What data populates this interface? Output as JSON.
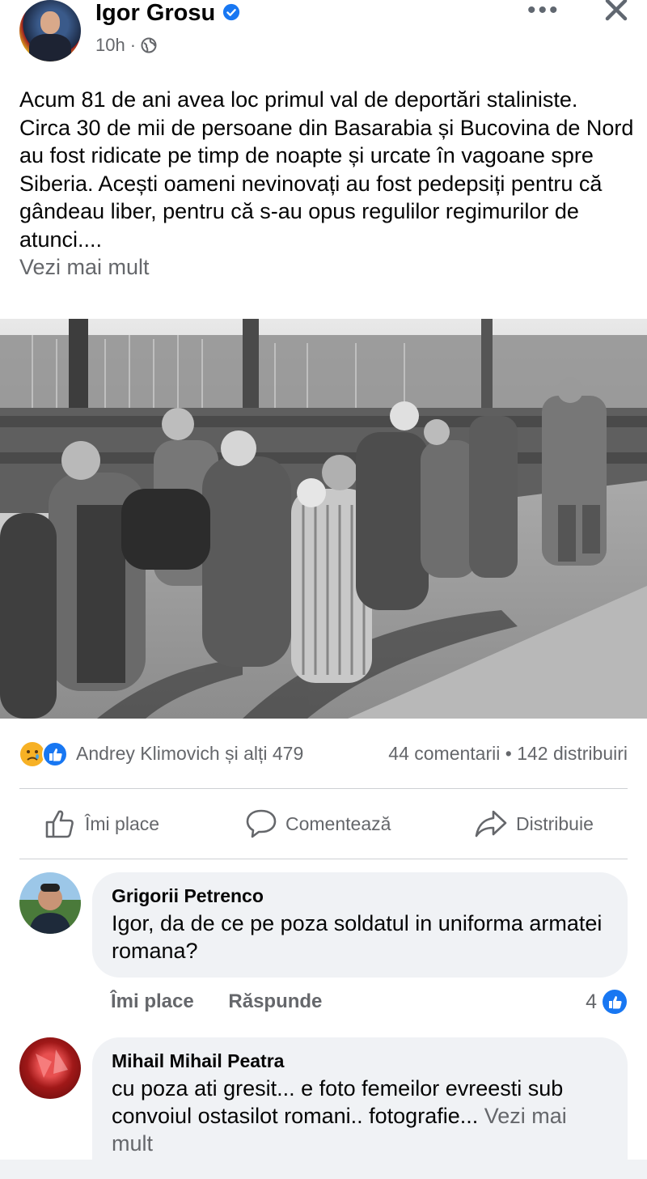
{
  "post": {
    "author": "Igor Grosu",
    "time": "10h",
    "time_separator": "·",
    "more_label": "•••",
    "text": "Acum 81 de ani avea loc primul val de deportări staliniste. Circa 30 de mii de persoane din Basarabia și Bucovina de Nord au fost ridicate pe timp de noapte și urcate în vagoane spre Siberia. Acești oameni nevinovați au fost pedepsiți pentru că gândeau liber, pentru că s-au opus regulilor regimurilor de atunci....",
    "see_more": "Vezi mai mult"
  },
  "reactions": {
    "names": "Andrey Klimovich și alți 479",
    "comments": "44 comentarii",
    "dot": "•",
    "shares": "142 distribuiri"
  },
  "actions": {
    "like": "Îmi place",
    "comment": "Comentează",
    "share": "Distribuie"
  },
  "comments": [
    {
      "name": "Grigorii  Petrenco",
      "text": "Igor, da de ce pe poza soldatul in uniforma armatei romana?",
      "like": "Îmi place",
      "reply": "Răspunde",
      "like_count": "4"
    },
    {
      "name": "Mihail Mihail Peatra",
      "text": "cu poza ati gresit... e foto femeilor evreesti sub convoiul ostasilot romani.. fotografie...",
      "see_more": "Vezi mai mult"
    }
  ],
  "colors": {
    "facebook_blue": "#1877f2",
    "secondary_text": "#65676b",
    "bubble_bg": "#f0f2f5"
  }
}
